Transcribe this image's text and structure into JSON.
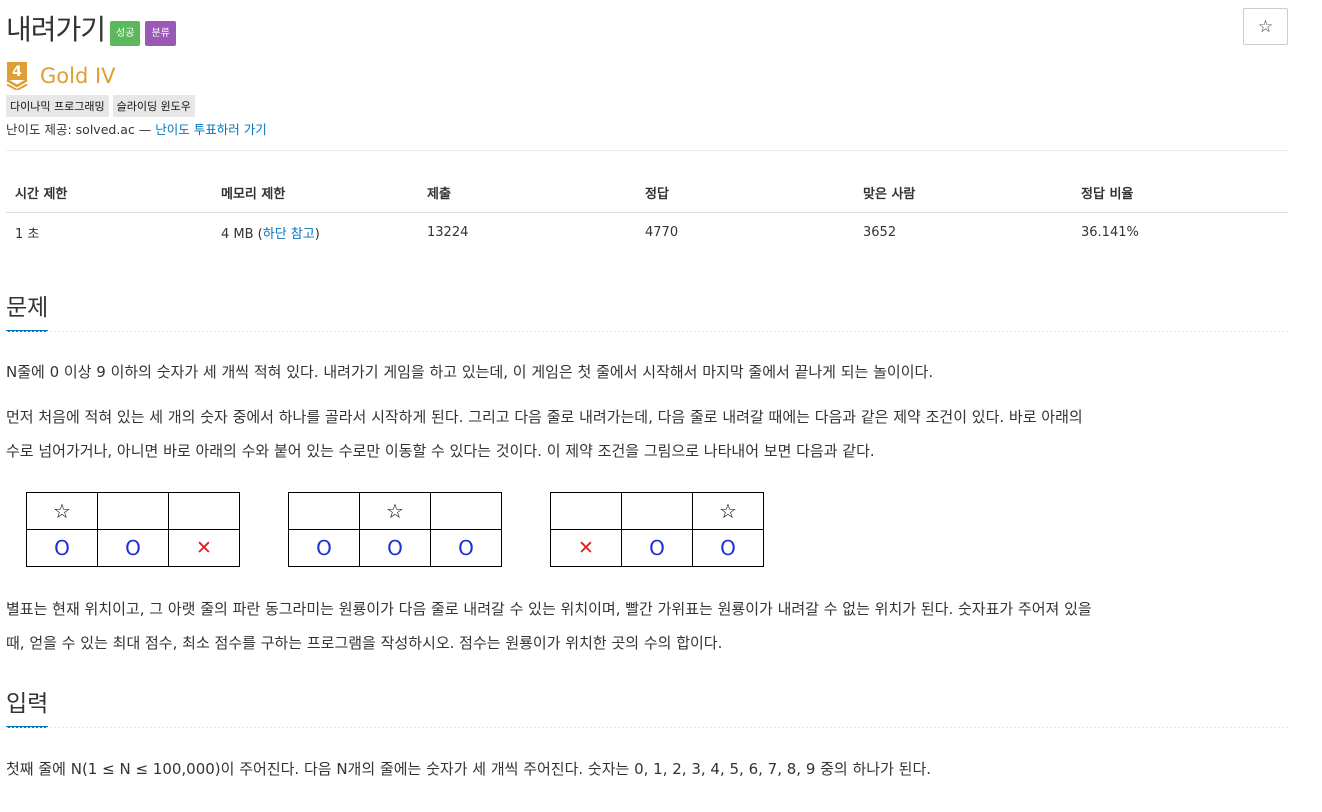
{
  "problem": {
    "title": "내려가기",
    "labels": [
      "성공",
      "분류"
    ],
    "star_button": "☆"
  },
  "tier": {
    "number": "4",
    "name": "Gold IV",
    "color": "#e09e37"
  },
  "tags": [
    "다이나믹 프로그래밍",
    "슬라이딩 윈도우"
  ],
  "provider": {
    "prefix": "난이도 제공: solved.ac — ",
    "link": "난이도 투표하러 가기"
  },
  "info_table": {
    "headers": [
      "시간 제한",
      "메모리 제한",
      "제출",
      "정답",
      "맞은 사람",
      "정답 비율"
    ],
    "time": "1 초",
    "memory_prefix": "4 MB (",
    "memory_link": "하단 참고",
    "memory_suffix": ")",
    "submissions": "13224",
    "accepted": "4770",
    "solvers": "3652",
    "ratio": "36.141%"
  },
  "sections": {
    "problem_title": "문제",
    "input_title": "입력"
  },
  "description": {
    "p1": "N줄에 0 이상 9 이하의 숫자가 세 개씩 적혀 있다. 내려가기 게임을 하고 있는데, 이 게임은 첫 줄에서 시작해서 마지막 줄에서 끝나게 되는 놀이이다.",
    "p2_line1": "먼저 처음에 적혀 있는 세 개의 숫자 중에서 하나를 골라서 시작하게 된다. 그리고 다음 줄로 내려가는데, 다음 줄로 내려갈 때에는 다음과 같은 제약 조건이 있다. 바로 아래의",
    "p2_line2": "수로 넘어가거나, 아니면 바로 아래의 수와 붙어 있는 수로만 이동할 수 있다는 것이다. 이 제약 조건을 그림으로 나타내어 보면 다음과 같다.",
    "p3_line1": "별표는 현재 위치이고, 그 아랫 줄의 파란 동그라미는 원룡이가 다음 줄로 내려갈 수 있는 위치이며, 빨간 가위표는 원룡이가 내려갈 수 없는 위치가 된다. 숫자표가 주어져 있을",
    "p3_line2": "때, 얻을 수 있는 최대 점수, 최소 점수를 구하는 프로그램을 작성하시오. 점수는 원룡이가 위치한 곳의 수의 합이다."
  },
  "input": {
    "p1": "첫째 줄에 N(1 ≤ N ≤ 100,000)이 주어진다. 다음 N개의 줄에는 숫자가 세 개씩 주어진다. 숫자는 0, 1, 2, 3, 4, 5, 6, 7, 8, 9 중의 하나가 된다."
  },
  "diagrams": {
    "star": "☆",
    "circle": "O",
    "cross": "✕"
  }
}
